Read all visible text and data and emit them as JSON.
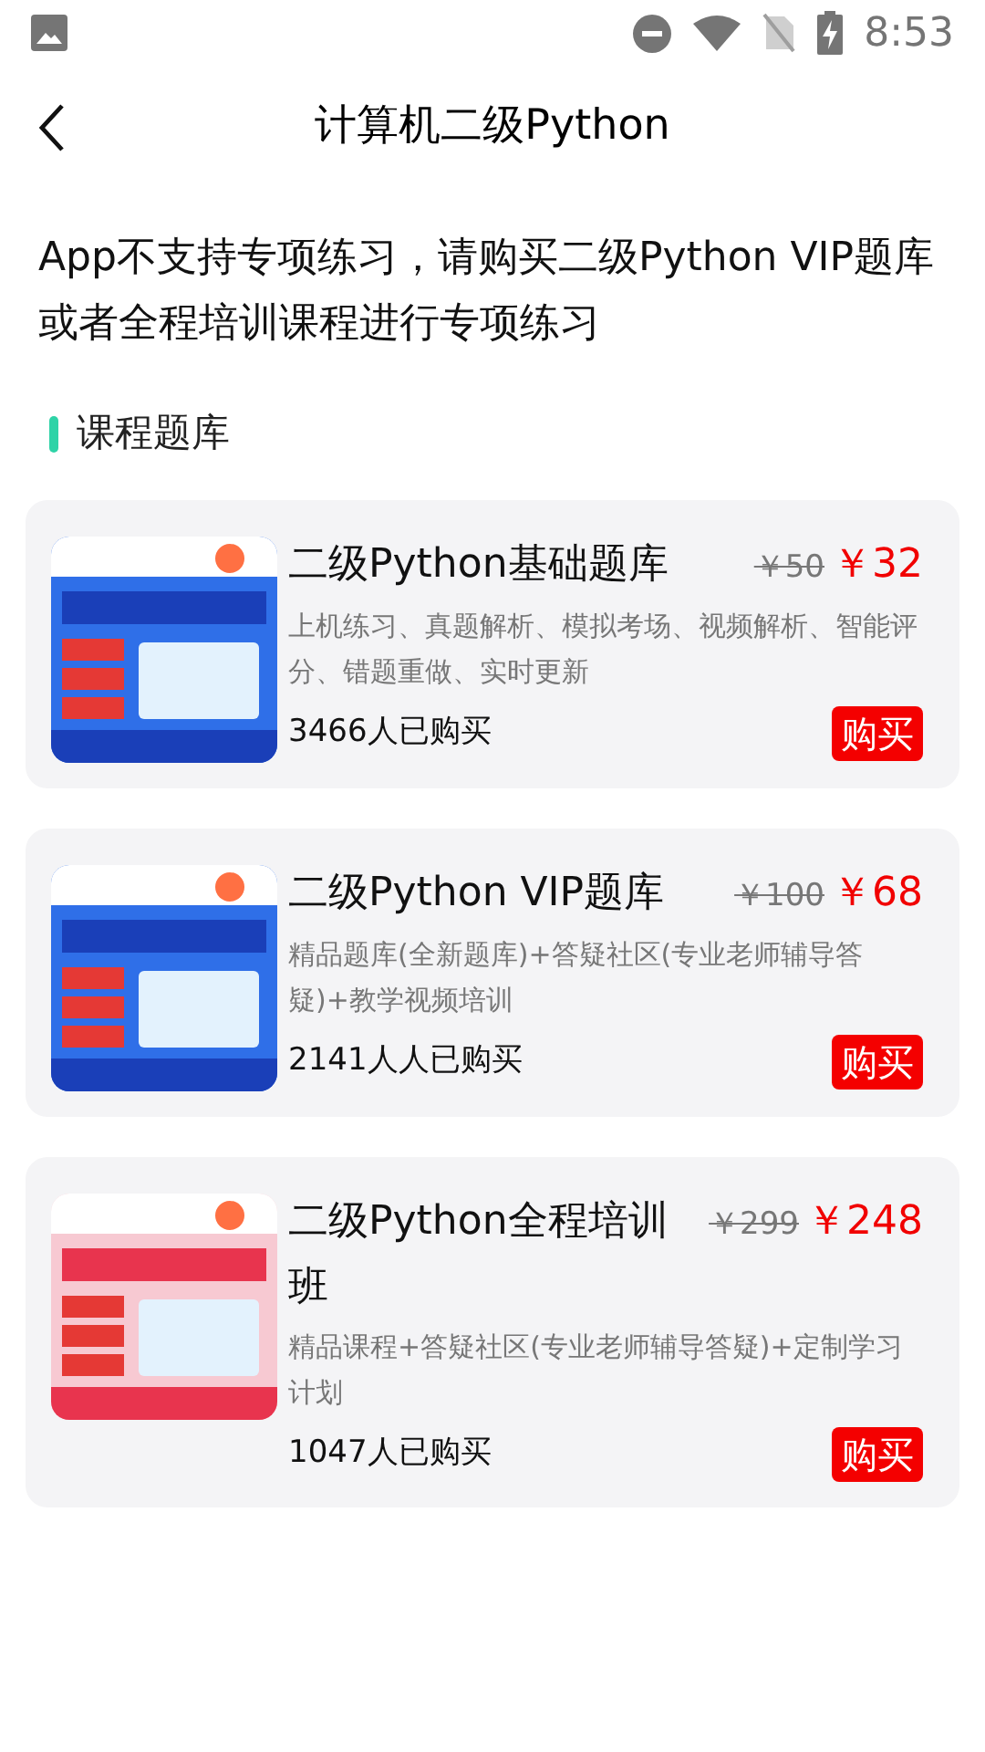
{
  "status_bar": {
    "time": "8:53"
  },
  "header": {
    "title": "计算机二级Python"
  },
  "notice": "App不支持专项练习，请购买二级Python VIP题库或者全程培训课程进行专项练习",
  "section": {
    "title": "课程题库"
  },
  "products": [
    {
      "title": "二级Python基础题库",
      "old_price": "￥50",
      "price": "￥32",
      "description": "上机练习、真题解析、模拟考场、视频解析、智能评分、错题重做、实时更新",
      "buyers": "3466人已购买",
      "button": "购买"
    },
    {
      "title": "二级Python VIP题库",
      "old_price": "￥100",
      "price": "￥68",
      "description": "精品题库(全新题库)+答疑社区(专业老师辅导答疑)+教学视频培训",
      "buyers": "2141人人已购买",
      "button": "购买"
    },
    {
      "title": "二级Python全程培训班",
      "old_price": "￥299",
      "price": "￥248",
      "description": "精品课程+答疑社区(专业老师辅导答疑)+定制学习计划",
      "buyers": "1047人已购买",
      "button": "购买"
    }
  ]
}
